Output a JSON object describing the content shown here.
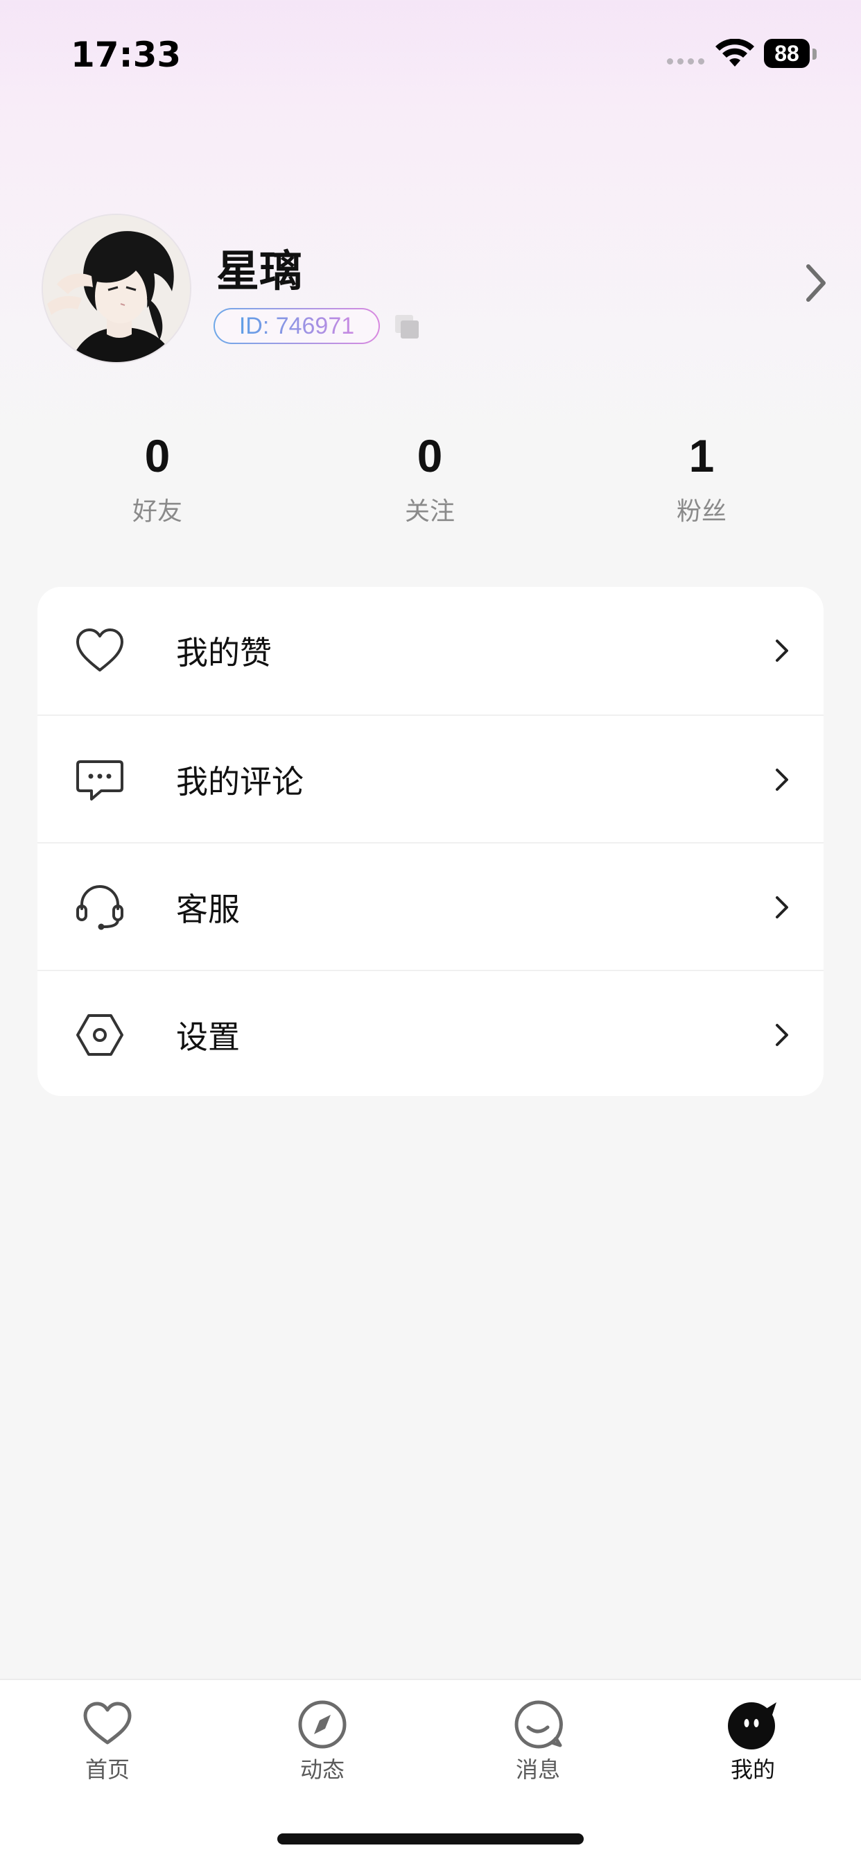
{
  "status_bar": {
    "time": "17:33",
    "battery": "88"
  },
  "profile": {
    "name": "星璃",
    "id_text": "ID: 746971"
  },
  "stats": [
    {
      "value": "0",
      "label": "好友"
    },
    {
      "value": "0",
      "label": "关注"
    },
    {
      "value": "1",
      "label": "粉丝"
    }
  ],
  "menu": [
    {
      "label": "我的赞",
      "icon": "heart-icon"
    },
    {
      "label": "我的评论",
      "icon": "comment-icon"
    },
    {
      "label": "客服",
      "icon": "headset-icon"
    },
    {
      "label": "设置",
      "icon": "settings-hexagon-icon"
    }
  ],
  "tabs": [
    {
      "label": "首页",
      "icon": "heart-icon",
      "active": false
    },
    {
      "label": "动态",
      "icon": "compass-icon",
      "active": false
    },
    {
      "label": "消息",
      "icon": "chat-bubble-icon",
      "active": false
    },
    {
      "label": "我的",
      "icon": "mascot-face-icon",
      "active": true
    }
  ],
  "colors": {
    "background": "#f6f6f6",
    "gradient_top": "#f5e6f7",
    "id_gradient_start": "#5f9fe6",
    "id_gradient_end": "#c989e2",
    "card": "#ffffff",
    "text_primary": "#111111",
    "text_secondary": "#8a8a8a"
  }
}
